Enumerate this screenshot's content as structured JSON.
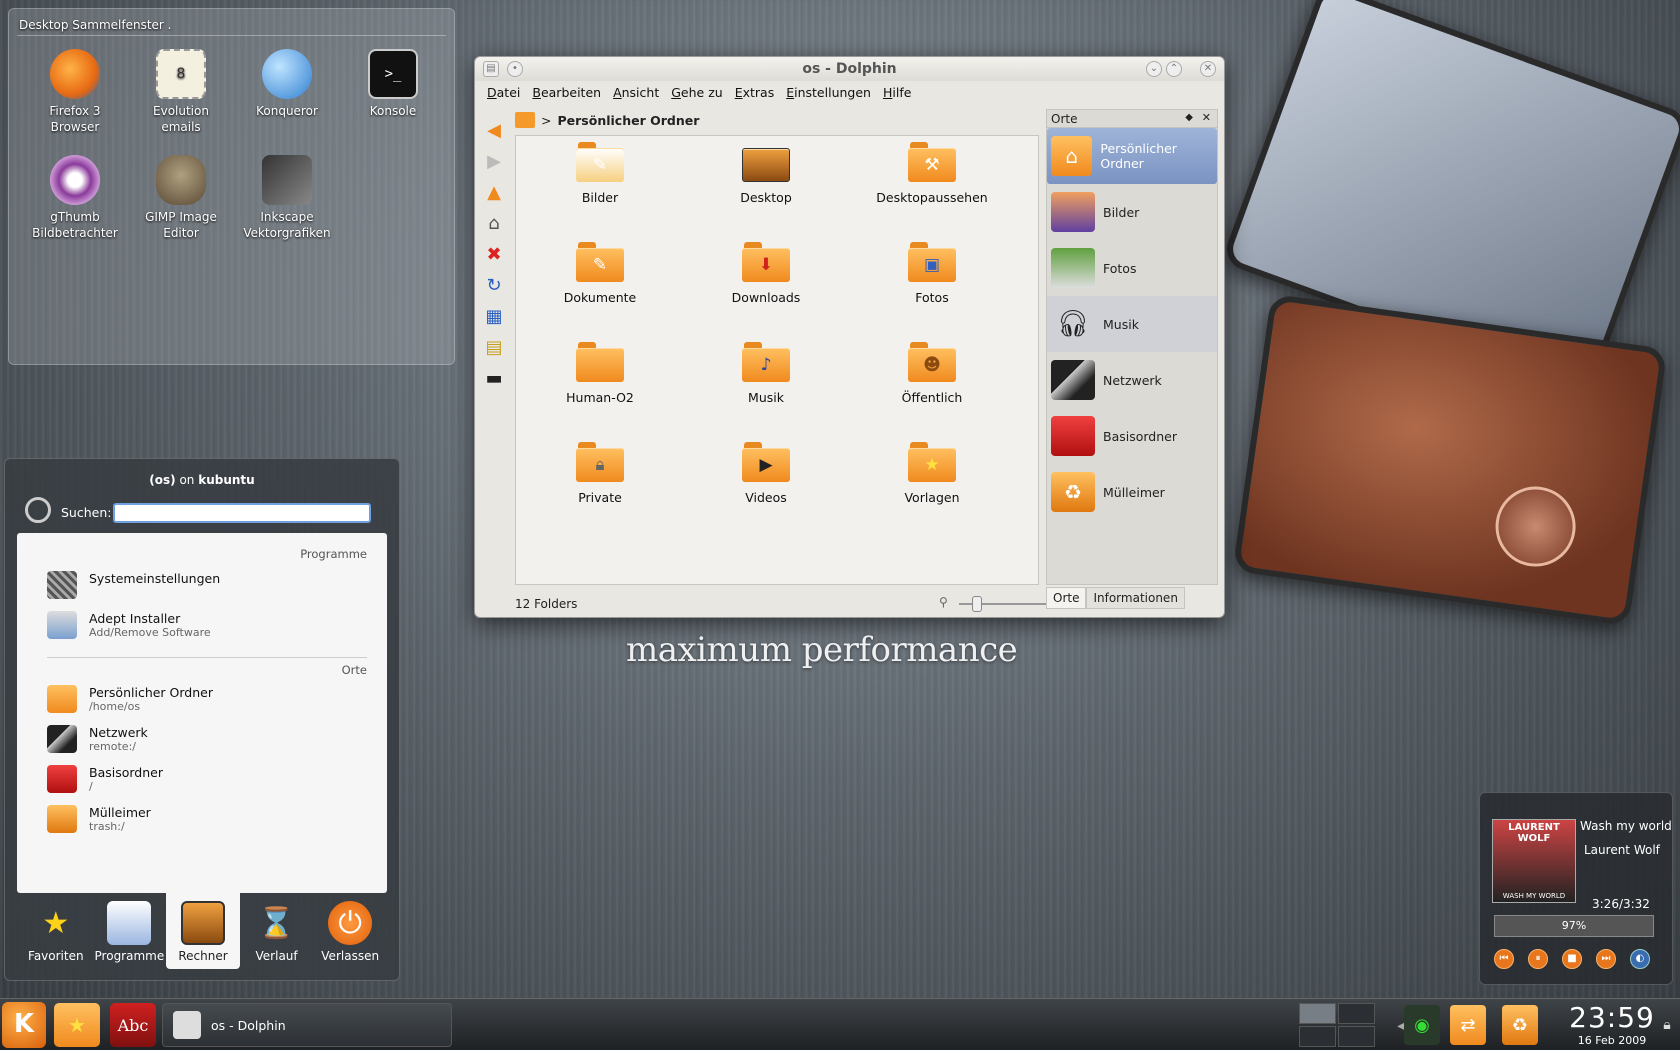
{
  "desktop_folder": {
    "title": "Desktop Sammelfenster .",
    "icons": [
      {
        "line1": "Firefox 3",
        "line2": "Browser",
        "color": "#e76a12"
      },
      {
        "line1": "Evolution",
        "line2": "emails",
        "color": "#5a8a3a"
      },
      {
        "line1": "Konqueror",
        "line2": "",
        "color": "#3b8fd8"
      },
      {
        "line1": "Konsole",
        "line2": "",
        "color": "#1a1a1a"
      },
      {
        "line1": "gThumb",
        "line2": "Bildbetrachter",
        "color": "#8a3a9a"
      },
      {
        "line1": "GIMP Image",
        "line2": "Editor",
        "color": "#7a6a50"
      },
      {
        "line1": "Inkscape",
        "line2": "Vektorgrafiken",
        "color": "#555555"
      }
    ]
  },
  "dolphin": {
    "title": "os - Dolphin",
    "menu": [
      "Datei",
      "Bearbeiten",
      "Ansicht",
      "Gehe zu",
      "Extras",
      "Einstellungen",
      "Hilfe"
    ],
    "breadcrumb": "Persönlicher Ordner",
    "folders": [
      "Bilder",
      "Desktop",
      "Desktopaussehen",
      "Dokumente",
      "Downloads",
      "Fotos",
      "Human-O2",
      "Musik",
      "Öffentlich",
      "Private",
      "Videos",
      "Vorlagen"
    ],
    "status": "12 Folders",
    "zoom_level": 0.2,
    "places_title": "Orte",
    "places": [
      "Persönlicher Ordner",
      "Bilder",
      "Fotos",
      "Musik",
      "Netzwerk",
      "Basisordner",
      "Mülleimer"
    ],
    "panel_tabs": [
      "Orte",
      "Informationen"
    ]
  },
  "tagline": "maximum performance",
  "kickoff": {
    "user": "(os)",
    "on": "on",
    "host": "kubuntu",
    "search_label": "Suchen:",
    "search_value": "",
    "section_programs": "Programme",
    "programs": [
      {
        "title": "Systemeinstellungen",
        "sub": ""
      },
      {
        "title": "Adept Installer",
        "sub": "Add/Remove Software"
      }
    ],
    "section_places": "Orte",
    "places": [
      {
        "title": "Persönlicher Ordner",
        "sub": "/home/os"
      },
      {
        "title": "Netzwerk",
        "sub": "remote:/"
      },
      {
        "title": "Basisordner",
        "sub": "/"
      },
      {
        "title": "Mülleimer",
        "sub": "trash:/"
      }
    ],
    "tabs": [
      "Favoriten",
      "Programme",
      "Rechner",
      "Verlauf",
      "Verlassen"
    ]
  },
  "player": {
    "cover_artist": "LAURENT WOLF",
    "cover_title": "WASH MY WORLD",
    "song": "Wash my world",
    "artist": "Laurent Wolf",
    "time": "3:26/3:32",
    "volume": "97%"
  },
  "taskbar": {
    "task": "os - Dolphin",
    "time": "23:59",
    "date": "16 Feb 2009"
  },
  "colors": {
    "accent": "#f08a1e",
    "selection": "#7a93c2"
  }
}
